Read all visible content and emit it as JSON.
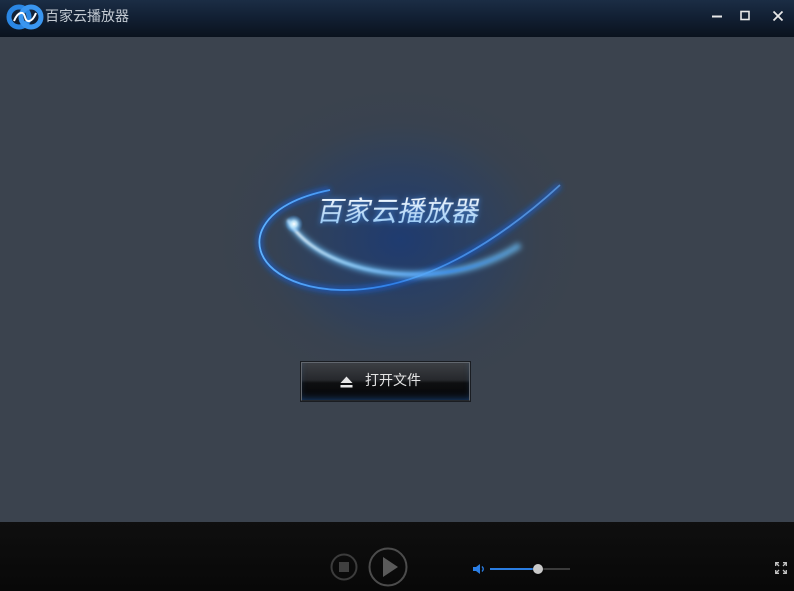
{
  "window": {
    "title": "百家云播放器",
    "logo_icon": "baijiayun-logo-icon",
    "controls": {
      "minimize_icon": "minimize-icon",
      "maximize_icon": "maximize-icon",
      "close_icon": "close-icon"
    }
  },
  "splash": {
    "brand": "百家云播放器",
    "open_button": {
      "label": "打开文件",
      "icon": "eject-icon"
    }
  },
  "controls": {
    "stop_icon": "stop-icon",
    "play_icon": "play-icon",
    "volume_icon": "volume-icon",
    "volume_level": 0.6,
    "fullscreen_icon": "fullscreen-icon"
  },
  "colors": {
    "accent": "#2a7de1",
    "title_bar": "#122034",
    "stage": "#3b434e",
    "control_bar": "#0b0b0b"
  }
}
